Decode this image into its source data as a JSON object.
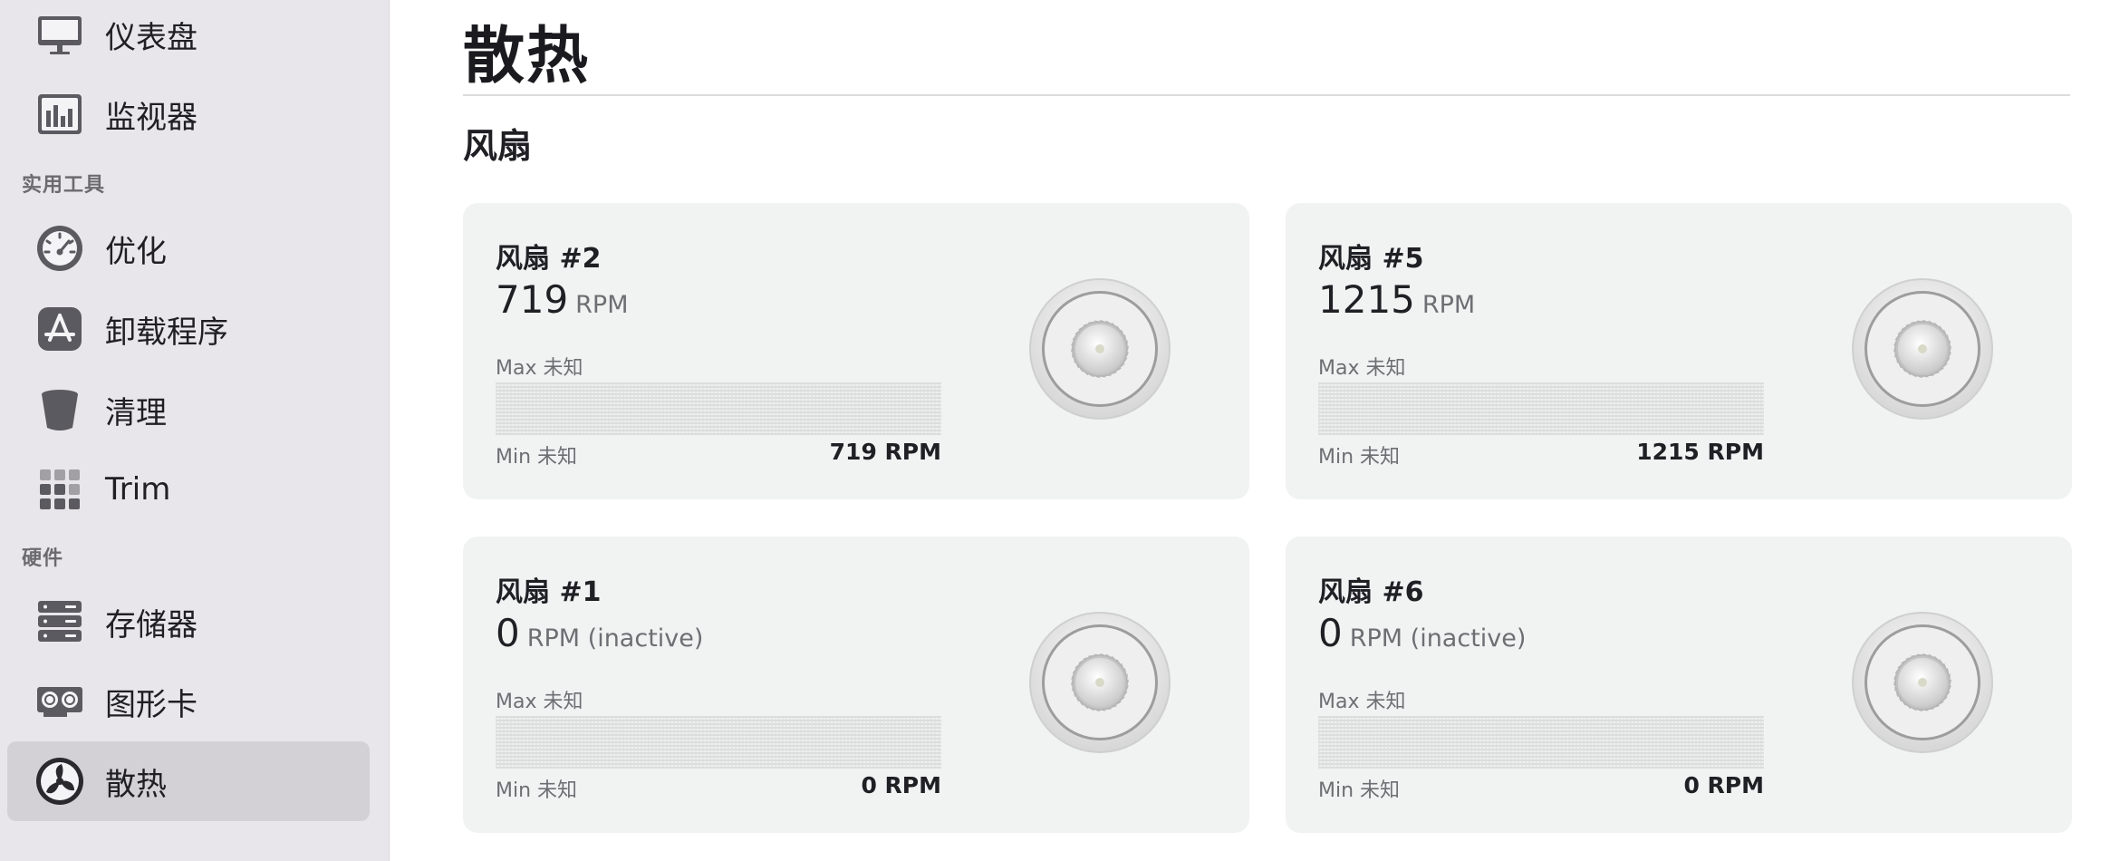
{
  "sidebar": {
    "items_top": [
      {
        "label": "仪表盘",
        "icon": "monitor-icon"
      },
      {
        "label": "监视器",
        "icon": "chart-bars-icon"
      }
    ],
    "section_utilities": "实用工具",
    "items_utilities": [
      {
        "label": "优化",
        "icon": "gauge-icon"
      },
      {
        "label": "卸载程序",
        "icon": "app-store-icon"
      },
      {
        "label": "清理",
        "icon": "trash-bin-icon"
      },
      {
        "label": "Trim",
        "icon": "grid-icon"
      }
    ],
    "section_hardware": "硬件",
    "items_hardware": [
      {
        "label": "存储器",
        "icon": "storage-icon"
      },
      {
        "label": "图形卡",
        "icon": "graphics-card-icon"
      },
      {
        "label": "散热",
        "icon": "fan-icon",
        "selected": true
      }
    ]
  },
  "main": {
    "title": "散热",
    "section": "风扇",
    "fans": [
      {
        "name": "风扇 #2",
        "speed": "719",
        "unit": "RPM",
        "max": "Max 未知",
        "min": "Min 未知",
        "current": "719 RPM",
        "fill": 0
      },
      {
        "name": "风扇 #5",
        "speed": "1215",
        "unit": "RPM",
        "max": "Max 未知",
        "min": "Min 未知",
        "current": "1215 RPM",
        "fill": 0
      },
      {
        "name": "风扇 #1",
        "speed": "0",
        "unit": "RPM (inactive)",
        "max": "Max 未知",
        "min": "Min 未知",
        "current": "0 RPM",
        "fill": 0
      },
      {
        "name": "风扇 #6",
        "speed": "0",
        "unit": "RPM (inactive)",
        "max": "Max 未知",
        "min": "Min 未知",
        "current": "0 RPM",
        "fill": 0
      }
    ]
  },
  "colors": {
    "sidebar_bg": "#e8e6ea",
    "selected_bg": "#d3d1d6",
    "card_bg": "#f1f3f3",
    "text": "#1f1f24",
    "muted": "#6e6e73"
  }
}
